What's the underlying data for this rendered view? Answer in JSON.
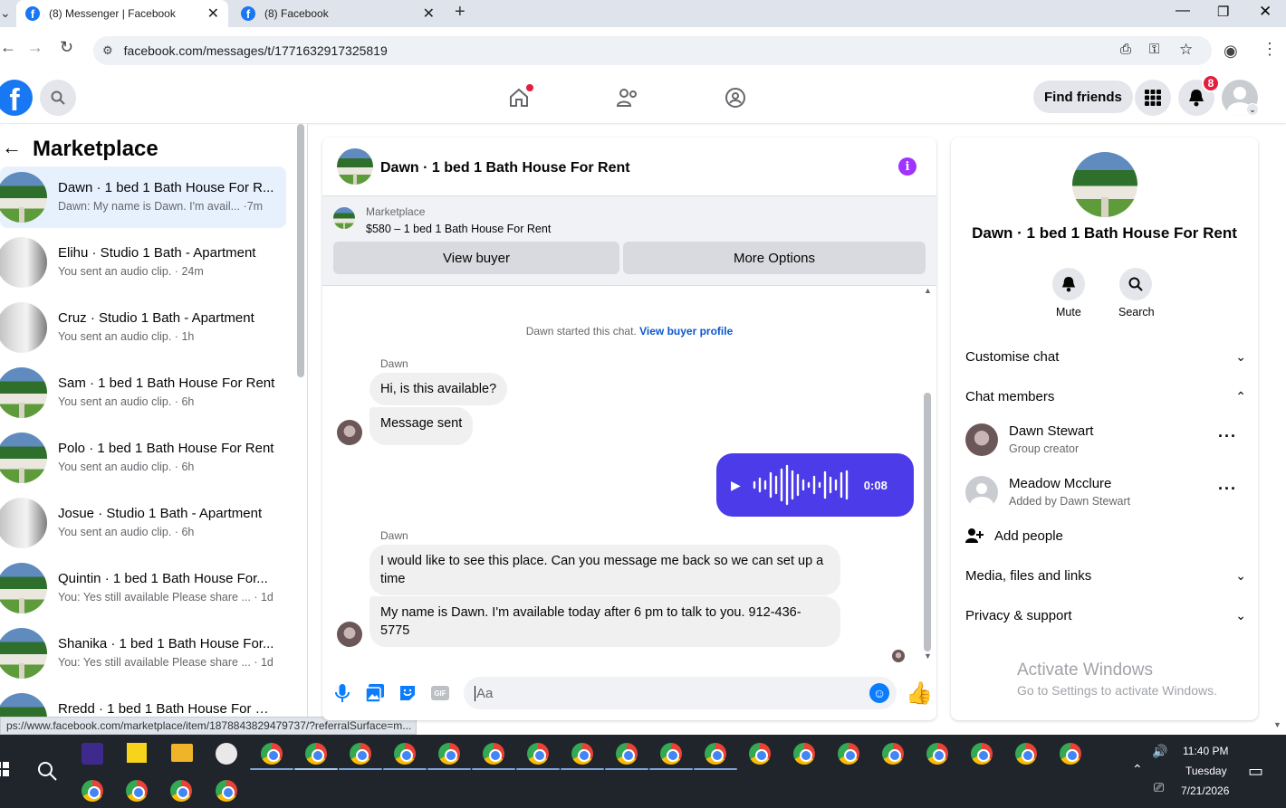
{
  "browser": {
    "tabs": [
      {
        "title": "(8) Messenger | Facebook"
      },
      {
        "title": "(8) Facebook"
      }
    ],
    "url": "facebook.com/messages/t/1771632917325819",
    "status_url": "ps://www.facebook.com/marketplace/item/1878843829479737/?referralSurface=m..."
  },
  "header": {
    "find_friends": "Find friends",
    "notification_count": "8"
  },
  "sidebar": {
    "title": "Marketplace",
    "conversations": [
      {
        "title": "Dawn · 1 bed 1 Bath House For R...",
        "subtitle": "Dawn: My name is Dawn. I'm avail... ·7m",
        "avatar": "house"
      },
      {
        "title": "Elihu · Studio 1 Bath - Apartment",
        "subtitle": "You sent an audio clip. · 24m",
        "avatar": "apartment"
      },
      {
        "title": "Cruz · Studio 1 Bath - Apartment",
        "subtitle": "You sent an audio clip. · 1h",
        "avatar": "apartment"
      },
      {
        "title": "Sam · 1 bed 1 Bath House For Rent",
        "subtitle": "You sent an audio clip. · 6h",
        "avatar": "house"
      },
      {
        "title": "Polo · 1 bed 1 Bath House For Rent",
        "subtitle": "You sent an audio clip. · 6h",
        "avatar": "house"
      },
      {
        "title": "Josue · Studio 1 Bath - Apartment",
        "subtitle": "You sent an audio clip. · 6h",
        "avatar": "apartment"
      },
      {
        "title": "Quintin · 1 bed 1 Bath House For...",
        "subtitle": "You: Yes still available Please share ... · 1d",
        "avatar": "house"
      },
      {
        "title": "Shanika · 1 bed 1 Bath House For...",
        "subtitle": "You: Yes still available Please share ... · 1d",
        "avatar": "house"
      },
      {
        "title": "Rredd · 1 bed 1 Bath House For R...",
        "subtitle": "",
        "avatar": "house"
      }
    ]
  },
  "chat": {
    "title": "Dawn · 1 bed 1 Bath House For Rent",
    "listing": {
      "label": "Marketplace",
      "price_title": "$580 – 1 bed 1 Bath House For Rent",
      "view_buyer": "View buyer",
      "more_options": "More Options"
    },
    "started_text": "Dawn started this chat.",
    "view_buyer_profile": "View buyer profile",
    "messages": [
      {
        "sender": "Dawn",
        "text": "Hi, is this available?"
      },
      {
        "sender": "",
        "text": "Message sent"
      },
      {
        "sender": "me",
        "type": "audio",
        "duration": "0:08"
      },
      {
        "sender": "Dawn",
        "text": "I would like to see this place. Can you message me back so we can set up a time"
      },
      {
        "sender": "",
        "text": "My name is Dawn. I'm available today after 6 pm to talk to you. 912-436-5775"
      }
    ],
    "composer_placeholder": "Aa"
  },
  "info_panel": {
    "title": "Dawn · 1 bed 1 Bath House For Rent",
    "mute_label": "Mute",
    "search_label": "Search",
    "sections": {
      "customise": "Customise chat",
      "members": "Chat members",
      "media": "Media, files and links",
      "privacy": "Privacy & support"
    },
    "members": [
      {
        "name": "Dawn Stewart",
        "role": "Group creator"
      },
      {
        "name": "Meadow Mcclure",
        "role": "Added by Dawn Stewart"
      }
    ],
    "add_people": "Add people",
    "watermark_title": "Activate Windows",
    "watermark_sub": "Go to Settings to activate Windows."
  },
  "taskbar": {
    "time": "11:40 PM",
    "day": "Tuesday",
    "date": "7/21/2026"
  },
  "colors": {
    "messenger_blue": "#0a7cff",
    "audio_bubble": "#4b3be8",
    "fb_blue": "#1877f2",
    "notification_red": "#e41e3f",
    "info_purple": "#a033ff"
  }
}
